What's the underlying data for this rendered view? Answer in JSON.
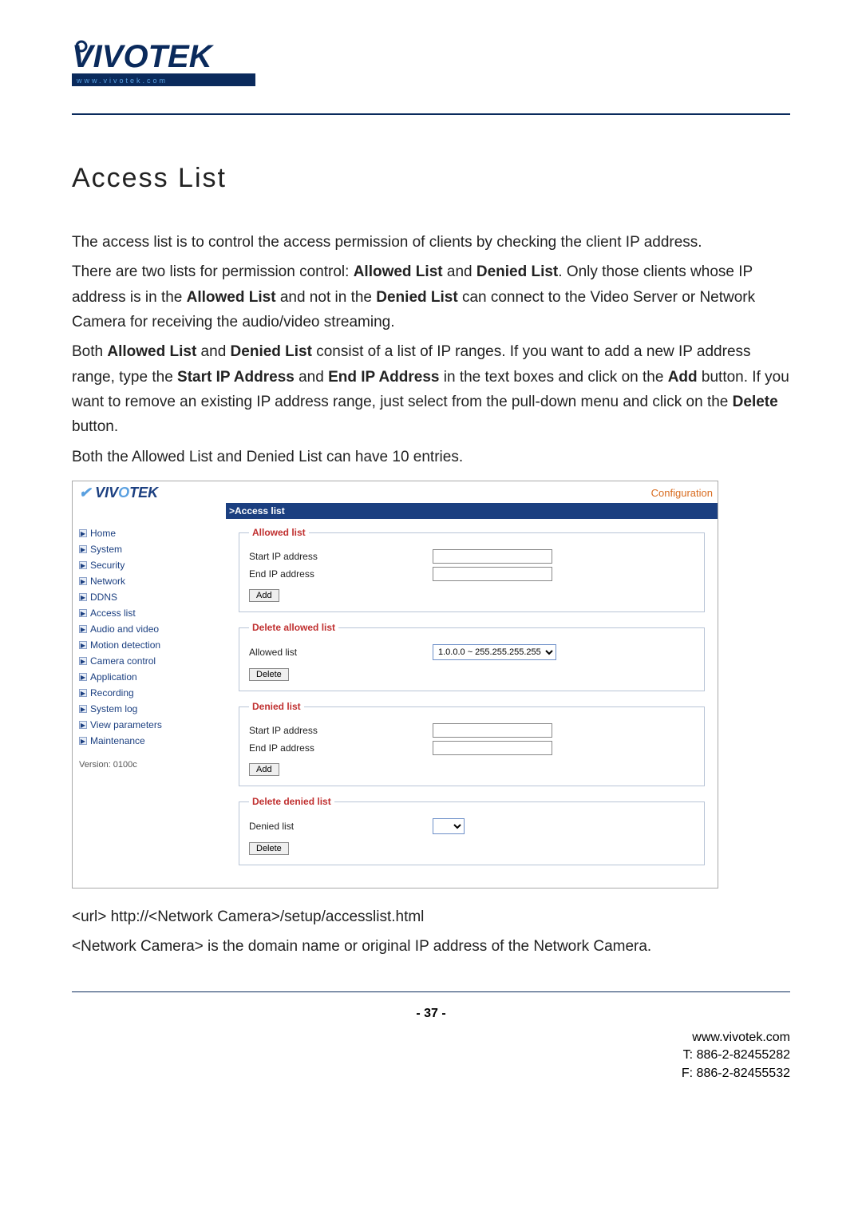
{
  "logo": {
    "brand": "VIVOTEK",
    "sub": "www.vivotek.com"
  },
  "doc": {
    "title": "Access List",
    "para1": "The access list is to control the access permission of clients by checking the client IP address.",
    "para2_a": "There are two lists for permission control: ",
    "para2_b": "Allowed List",
    "para2_c": " and ",
    "para2_d": "Denied List",
    "para2_e": ". Only those clients whose IP address is in the ",
    "para2_f": "Allowed List",
    "para2_g": " and not in the ",
    "para2_h": "Denied List",
    "para2_i": " can connect to the Video Server or Network Camera for receiving the audio/video streaming.",
    "para3_a": "Both ",
    "para3_b": "Allowed List",
    "para3_c": " and ",
    "para3_d": "Denied List",
    "para3_e": " consist of a list of IP ranges. If you want to add a new IP address range, type the ",
    "para3_f": "Start IP Address",
    "para3_g": " and ",
    "para3_h": "End IP Address",
    "para3_i": " in the text boxes and click on the ",
    "para3_j": "Add",
    "para3_k": " button. If you want to remove an existing IP address range, just select from the pull-down menu and click on the ",
    "para3_l": "Delete",
    "para3_m": " button.",
    "para4": "Both the Allowed List and Denied List can have 10 entries.",
    "url_line": "<url> http://<Network Camera>/setup/accesslist.html",
    "url_note": "<Network Camera> is the domain name or original IP address of the Network Camera."
  },
  "ui": {
    "config_link": "Configuration",
    "titlebar": ">Access list",
    "sidebar": [
      "Home",
      "System",
      "Security",
      "Network",
      "DDNS",
      "Access list",
      "Audio and video",
      "Motion detection",
      "Camera control",
      "Application",
      "Recording",
      "System log",
      "View parameters",
      "Maintenance"
    ],
    "version": "Version: 0100c",
    "fs1_legend": "Allowed list",
    "lbl_start": "Start IP address",
    "lbl_end": "End IP address",
    "btn_add": "Add",
    "fs2_legend": "Delete allowed list",
    "lbl_allowed": "Allowed list",
    "allowed_option": "1.0.0.0 ~ 255.255.255.255",
    "btn_delete": "Delete",
    "fs3_legend": "Denied list",
    "fs4_legend": "Delete denied list",
    "lbl_denied": "Denied list"
  },
  "footer": {
    "page": "- 37 -",
    "site": "www.vivotek.com",
    "tel": "T: 886-2-82455282",
    "fax": "F: 886-2-82455532"
  }
}
